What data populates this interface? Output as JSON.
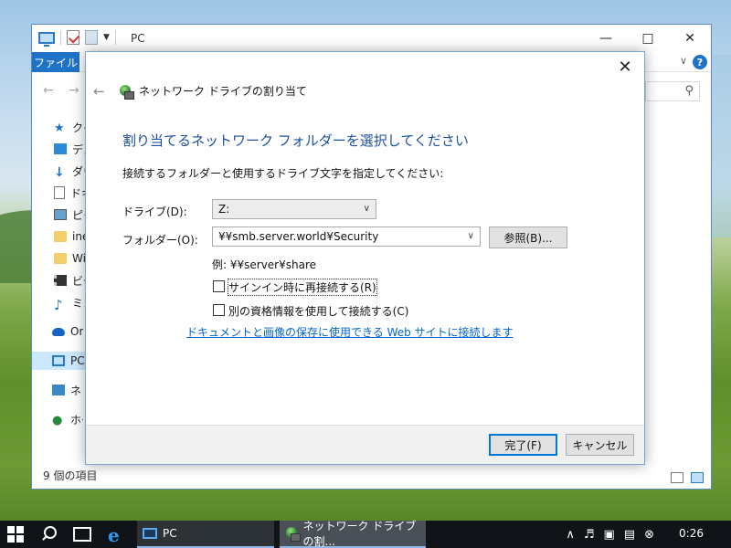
{
  "explorer": {
    "title": "PC",
    "ribbon_file": "ファイル",
    "help": "?",
    "nav_items": [
      {
        "label": "クイック アクセス",
        "icon": "star-icon"
      },
      {
        "label": "デスクトップ",
        "icon": "desktop-icon"
      },
      {
        "label": "ダウンロード",
        "icon": "download-icon"
      },
      {
        "label": "ドキュメント",
        "icon": "document-icon"
      },
      {
        "label": "ピクチャ",
        "icon": "picture-icon"
      },
      {
        "label": "inetpub",
        "icon": "folder-icon"
      },
      {
        "label": "Windows",
        "icon": "folder-icon"
      },
      {
        "label": "ビデオ",
        "icon": "video-icon"
      },
      {
        "label": "ミュージック",
        "icon": "music-icon"
      },
      {
        "label": "OneDrive",
        "icon": "cloud-icon"
      },
      {
        "label": "PC",
        "icon": "pc-icon"
      },
      {
        "label": "ネットワーク",
        "icon": "network-icon"
      },
      {
        "label": "ホームグループ",
        "icon": "homegroup-icon"
      }
    ],
    "status": "9 個の項目"
  },
  "dialog": {
    "title": "ネットワーク ドライブの割り当て",
    "heading": "割り当てるネットワーク フォルダーを選択してください",
    "description": "接続するフォルダーと使用するドライブ文字を指定してください:",
    "drive_label": "ドライブ(D):",
    "drive_value": "Z:",
    "folder_label": "フォルダー(O):",
    "folder_value": "¥¥smb.server.world¥Security",
    "browse_button": "参照(B)...",
    "example": "例: ¥¥server¥share",
    "reconnect_label": "サインイン時に再接続する(R)",
    "reconnect_checked": false,
    "credentials_label": "別の資格情報を使用して接続する(C)",
    "credentials_checked": false,
    "link": "ドキュメントと画像の保存に使用できる Web サイトに接続します",
    "finish_button": "完了(F)",
    "cancel_button": "キャンセル"
  },
  "taskbar": {
    "apps": [
      {
        "label": "PC"
      },
      {
        "label": "ネットワーク ドライブの割..."
      }
    ],
    "clock": "0:26"
  },
  "colors": {
    "accent": "#1e73c7",
    "heading": "#1c4f9c",
    "link": "#0066cc",
    "taskbar": "#101418"
  }
}
